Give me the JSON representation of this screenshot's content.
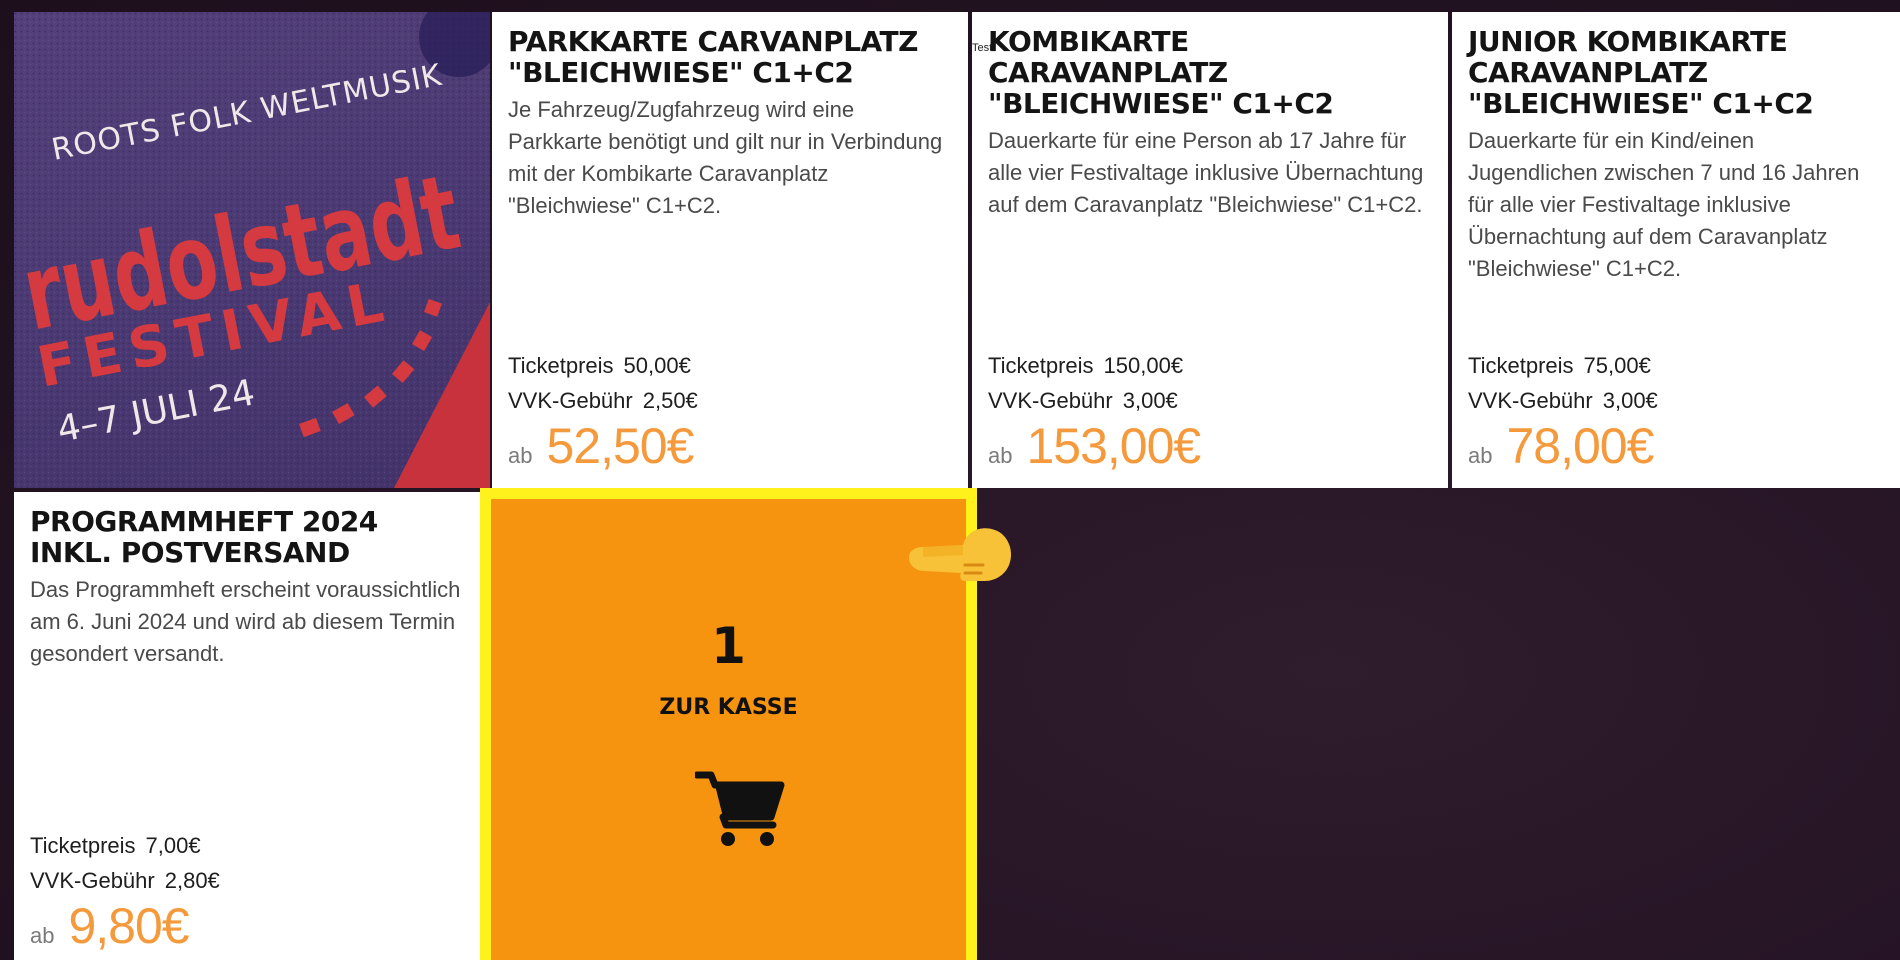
{
  "banner": {
    "tagline": "ROOTS FOLK WELTMUSIK",
    "logo_word": "rudolstadt",
    "festival_word": "FESTIVAL",
    "dates": "4–7 JULI 24"
  },
  "products": [
    {
      "title": "PARKKARTE CARVANPLATZ \"BLEICHWIESE\" C1+C2",
      "description": "Je Fahrzeug/Zugfahrzeug wird eine Parkkarte benötigt und gilt nur in Verbindung mit der Kombikarte Caravanplatz \"Bleichwiese\" C1+C2.",
      "ticket_label": "Ticketpreis",
      "ticket_price": "50,00€",
      "fee_label": "VVK-Gebühr",
      "fee": "2,50€",
      "from_label": "ab",
      "total": "52,50€"
    },
    {
      "title": "KOMBIKARTE CARAVANPLATZ \"BLEICHWIESE\" C1+C2",
      "description": "Dauerkarte für eine Person ab 17 Jahre für alle vier Festivaltage inklusive Übernachtung auf dem Caravanplatz \"Bleichwiese\" C1+C2.",
      "ticket_label": "Ticketpreis",
      "ticket_price": "150,00€",
      "fee_label": "VVK-Gebühr",
      "fee": "3,00€",
      "from_label": "ab",
      "total": "153,00€"
    },
    {
      "title": "JUNIOR KOMBIKARTE CARAVANPLATZ \"BLEICHWIESE\" C1+C2",
      "description": "Dauerkarte für ein Kind/einen Jugendlichen zwischen 7 und 16 Jahren für alle vier Festivaltage inklusive Übernachtung auf dem Caravanplatz \"Bleichwiese\" C1+C2.",
      "ticket_label": "Ticketpreis",
      "ticket_price": "75,00€",
      "fee_label": "VVK-Gebühr",
      "fee": "3,00€",
      "from_label": "ab",
      "total": "78,00€"
    },
    {
      "title": "PROGRAMMHEFT 2024 INKL. POSTVERSAND",
      "description": "Das Programmheft erscheint voraussichtlich am 6. Juni 2024 und wird ab diesem Termin gesondert versandt.",
      "ticket_label": "Ticketpreis",
      "ticket_price": "7,00€",
      "fee_label": "VVK-Gebühr",
      "fee": "2,80€",
      "from_label": "ab",
      "total": "9,80€"
    }
  ],
  "checkout": {
    "count": "1",
    "label": "ZUR KASSE"
  },
  "test_label": "Test",
  "colors": {
    "price_accent": "#f49a3c",
    "checkout_bg": "#f6940f",
    "checkout_border": "#fff21c",
    "banner_purple": "#4b3a73",
    "banner_red": "#d43a3f"
  },
  "icons": [
    "cart-icon",
    "pointing-hand-icon"
  ]
}
